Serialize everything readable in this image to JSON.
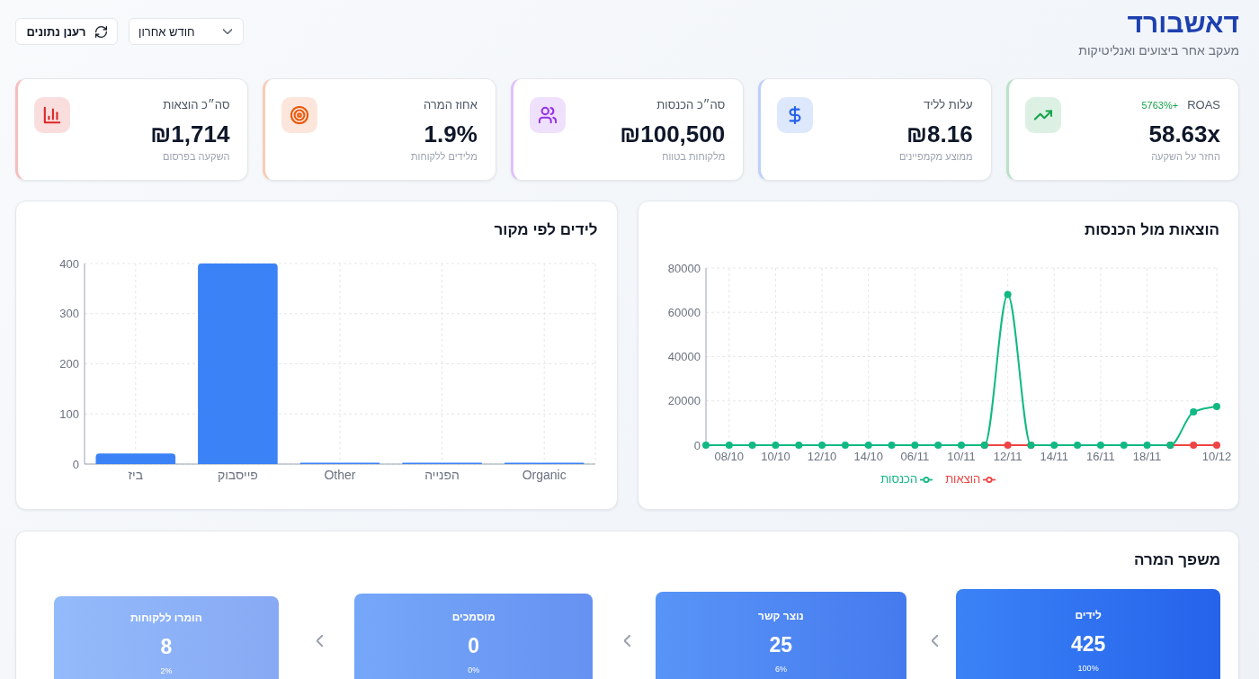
{
  "header": {
    "title": "דאשבורד",
    "subtitle": "מעקב אחר ביצועים ואנליטיקות",
    "period_select": {
      "value": "חודש אחרון"
    },
    "refresh_button": {
      "label": "רענן נתונים"
    }
  },
  "kpi_cards": [
    {
      "label": "ROAS",
      "badge": "+5763%",
      "value": "58.63x",
      "caption": "החזר על השקעה",
      "color": "#16a34a"
    },
    {
      "label": "עלות לליד",
      "value": "₪8.16",
      "caption": "ממוצע מקמפיינים",
      "color": "#2563eb"
    },
    {
      "label": "סה״כ הכנסות",
      "value": "₪100,500",
      "caption": "מלקוחות בטווח",
      "color": "#9333ea"
    },
    {
      "label": "אחוז המרה",
      "value": "1.9%",
      "caption": "מלידים ללקוחות",
      "color": "#ea580c"
    },
    {
      "label": "סה״כ הוצאות",
      "value": "₪1,714",
      "caption": "השקעה בפרסום",
      "color": "#dc2626"
    }
  ],
  "expenses_vs_revenue": {
    "title": "הוצאות מול הכנסות",
    "chart_data": {
      "type": "line",
      "categories": [
        null,
        "08/10",
        null,
        "10/10",
        null,
        "12/10",
        null,
        "14/10",
        null,
        "06/11",
        null,
        "10/11",
        null,
        "12/11",
        null,
        "14/11",
        null,
        "16/11",
        null,
        "18/11",
        null,
        null,
        "10/12"
      ],
      "ylim": [
        0,
        80000
      ],
      "yticks": [
        0,
        20000,
        40000,
        60000,
        80000
      ],
      "grid": true,
      "series": [
        {
          "name": "הוצאות",
          "color": "#ef4444",
          "marker": true,
          "values": [
            null,
            null,
            null,
            null,
            null,
            null,
            null,
            null,
            null,
            null,
            null,
            null,
            0,
            0,
            0,
            null,
            null,
            null,
            null,
            null,
            0,
            0,
            0
          ]
        },
        {
          "name": "הכנסות",
          "color": "#10b981",
          "marker": true,
          "values": [
            0,
            0,
            0,
            0,
            0,
            0,
            0,
            0,
            0,
            0,
            0,
            0,
            0,
            68000,
            0,
            0,
            0,
            0,
            0,
            0,
            0,
            15000,
            17500
          ]
        }
      ]
    }
  },
  "leads_by_source": {
    "title": "לידים לפי מקור",
    "chart_data": {
      "type": "bar",
      "categories": [
        "ביז",
        "פייסבוק",
        "Other",
        "הפנייה",
        "Organic"
      ],
      "values": [
        21,
        400,
        1,
        1,
        2
      ],
      "ylim": [
        0,
        400
      ],
      "yticks": [
        0,
        100,
        200,
        300,
        400
      ],
      "grid": true
    }
  },
  "conversion_funnel": {
    "title": "משפך המרה",
    "stages": [
      {
        "label": "לידים",
        "value": "425",
        "share": "100%"
      },
      {
        "label": "נוצר קשר",
        "value": "25",
        "share": "6%"
      },
      {
        "label": "מוסמכים",
        "value": "0",
        "share": "0%"
      },
      {
        "label": "הומרו ללקוחות",
        "value": "8",
        "share": "2%"
      }
    ]
  }
}
